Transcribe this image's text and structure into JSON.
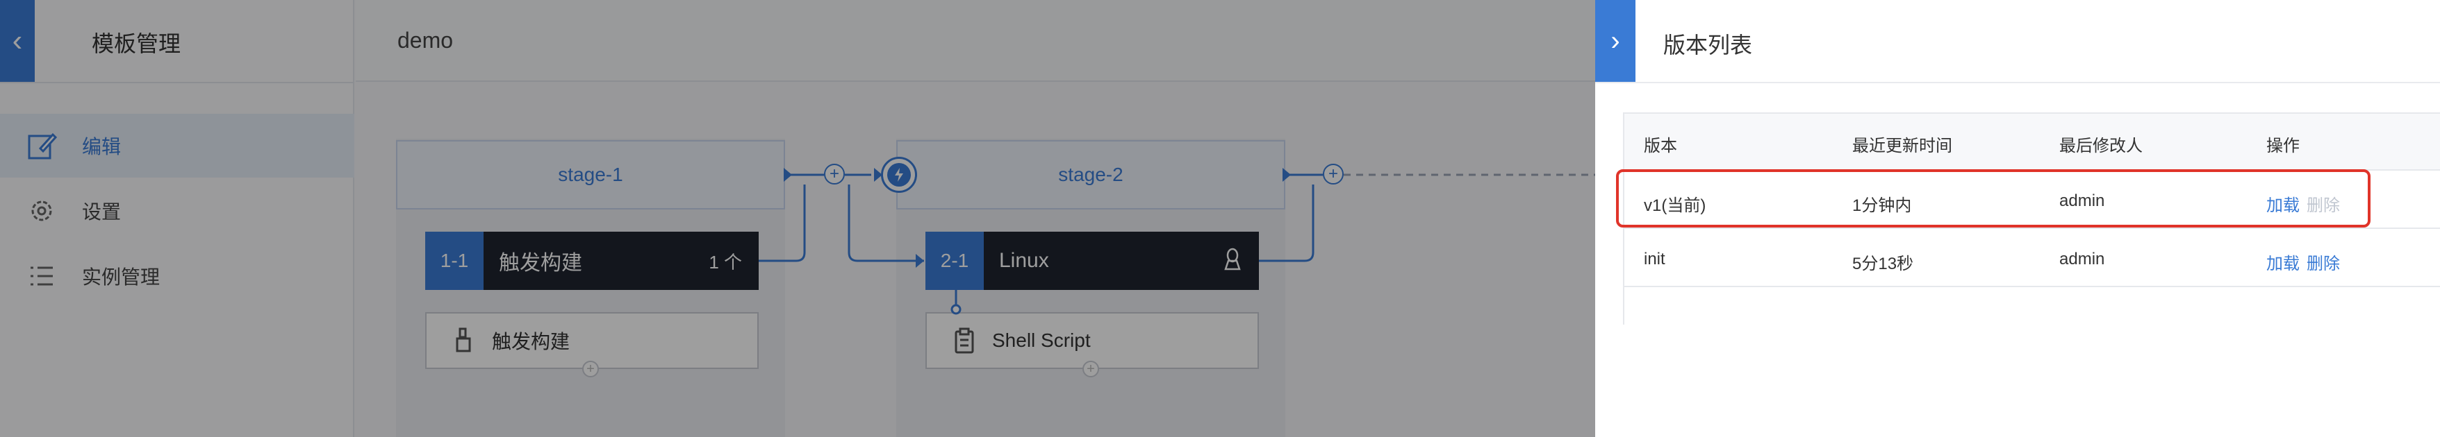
{
  "sidebar": {
    "back_icon": "chevron-left-icon",
    "title": "模板管理",
    "items": [
      {
        "label": "编辑",
        "icon": "edit-icon",
        "active": true
      },
      {
        "label": "设置",
        "icon": "gear-icon",
        "active": false
      },
      {
        "label": "实例管理",
        "icon": "list-icon",
        "active": false
      }
    ]
  },
  "header": {
    "project_name": "demo"
  },
  "pipeline": {
    "stages": [
      {
        "label": "stage-1",
        "job": {
          "num": "1-1",
          "name": "触发构建",
          "extra": "1 个"
        },
        "task": {
          "label": "触发构建",
          "icon": "trigger-icon"
        }
      },
      {
        "label": "stage-2",
        "job": {
          "num": "2-1",
          "name": "Linux",
          "extra_icon": "linux-icon"
        },
        "task": {
          "label": "Shell Script",
          "icon": "clipboard-icon"
        }
      }
    ]
  },
  "panel": {
    "toggle_icon": "chevron-right-icon",
    "title": "版本列表",
    "columns": [
      "版本",
      "最近更新时间",
      "最后修改人",
      "操作"
    ],
    "rows": [
      {
        "version": "v1(当前)",
        "updated": "1分钟内",
        "modifier": "admin",
        "load": "加载",
        "delete": "删除",
        "delete_disabled": true,
        "highlighted": true
      },
      {
        "version": "init",
        "updated": "5分13秒",
        "modifier": "admin",
        "load": "加载",
        "delete": "删除",
        "delete_disabled": false,
        "highlighted": false
      }
    ]
  },
  "colors": {
    "accent": "#3a7bd5",
    "highlight": "#e0342a",
    "job_bg": "#1f2430"
  }
}
